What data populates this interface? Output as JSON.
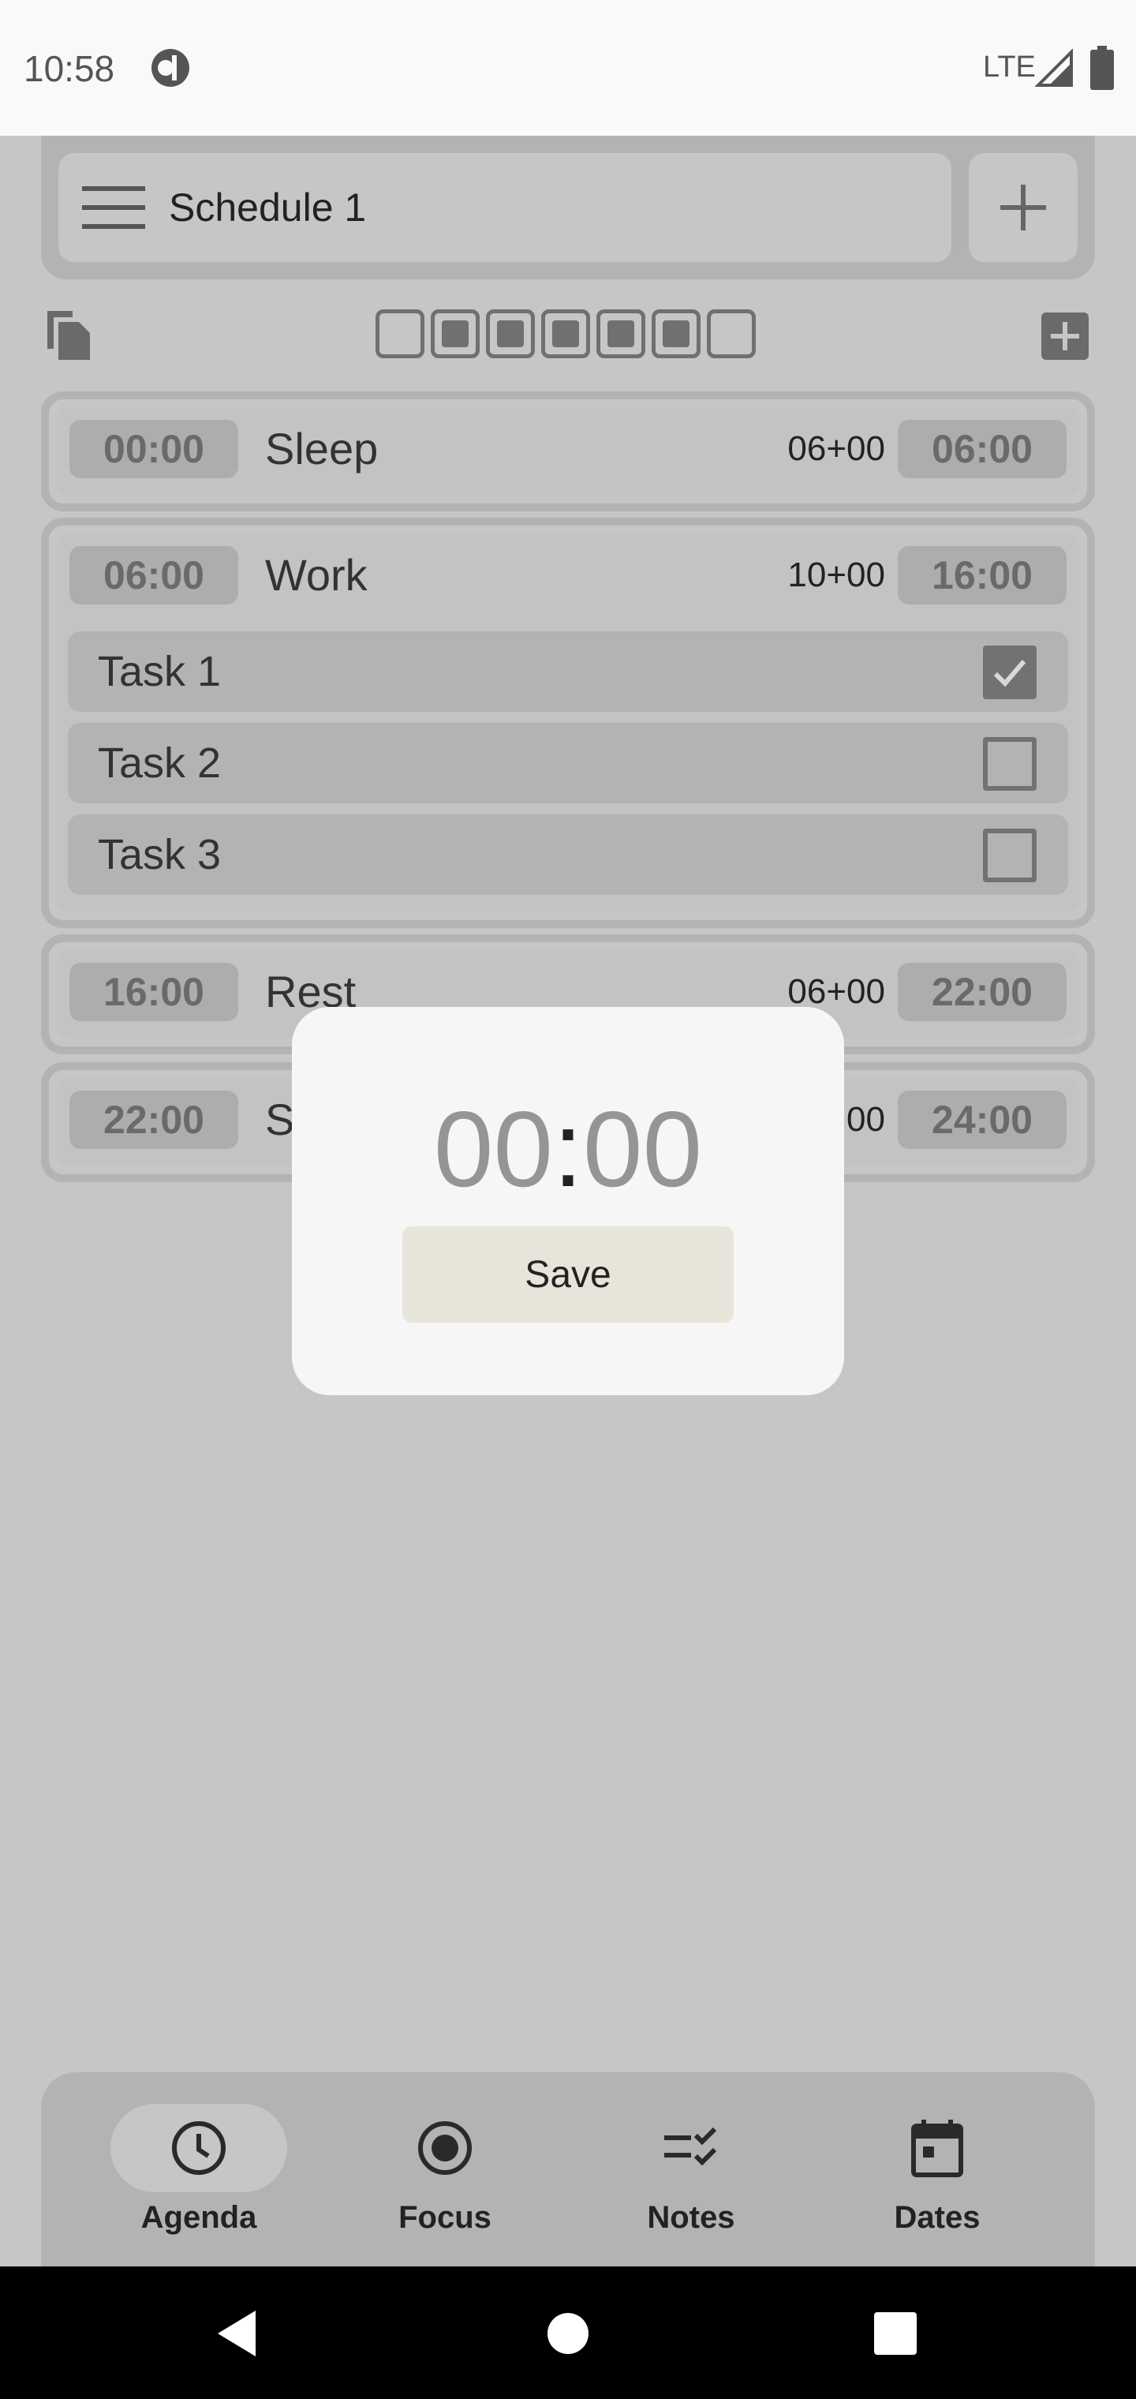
{
  "status": {
    "time": "10:58",
    "network": "LTE"
  },
  "header": {
    "schedule_title": "Schedule 1"
  },
  "toolbar": {
    "days": [
      false,
      true,
      true,
      true,
      true,
      true,
      false
    ]
  },
  "blocks": [
    {
      "start": "00:00",
      "name": "Sleep",
      "duration": "06+00",
      "end": "06:00"
    },
    {
      "start": "06:00",
      "name": "Work",
      "duration": "10+00",
      "end": "16:00",
      "tasks": [
        {
          "label": "Task 1",
          "done": true
        },
        {
          "label": "Task 2",
          "done": false
        },
        {
          "label": "Task 3",
          "done": false
        }
      ]
    },
    {
      "start": "16:00",
      "name": "Rest",
      "duration": "06+00",
      "end": "22:00"
    },
    {
      "start": "22:00",
      "name": "S",
      "duration": "00",
      "end": "24:00"
    }
  ],
  "dialog": {
    "hours": "00",
    "separator": ":",
    "minutes": "00",
    "save_label": "Save"
  },
  "nav": {
    "items": [
      {
        "label": "Agenda",
        "icon": "clock-icon"
      },
      {
        "label": "Focus",
        "icon": "target-icon"
      },
      {
        "label": "Notes",
        "icon": "checklist-icon"
      },
      {
        "label": "Dates",
        "icon": "calendar-icon"
      }
    ],
    "active": "Agenda"
  },
  "colors": {
    "overlay_bg": "#c6c6c6",
    "panel": "#b3b3b3",
    "dialog_bg": "#f6f6f6",
    "save_bg": "#e7e5da"
  }
}
